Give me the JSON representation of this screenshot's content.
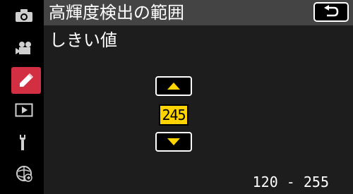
{
  "menu": {
    "title": "高輝度検出の範囲",
    "subtitle": "しきい値"
  },
  "sidebar": {
    "items": [
      {
        "icon": "camera-icon",
        "active": false
      },
      {
        "icon": "movie-camera-icon",
        "active": false
      },
      {
        "icon": "pencil-icon",
        "active": true
      },
      {
        "icon": "playback-icon",
        "active": false
      },
      {
        "icon": "wrench-icon",
        "active": false
      },
      {
        "icon": "network-icon",
        "active": false
      }
    ]
  },
  "value": {
    "current": "245",
    "range_text": "120 - 255"
  },
  "colors": {
    "active_tab": "#d22f43",
    "value_highlight": "#ffd400",
    "title_bar": "#444444",
    "panel": "#1d1d1d"
  }
}
